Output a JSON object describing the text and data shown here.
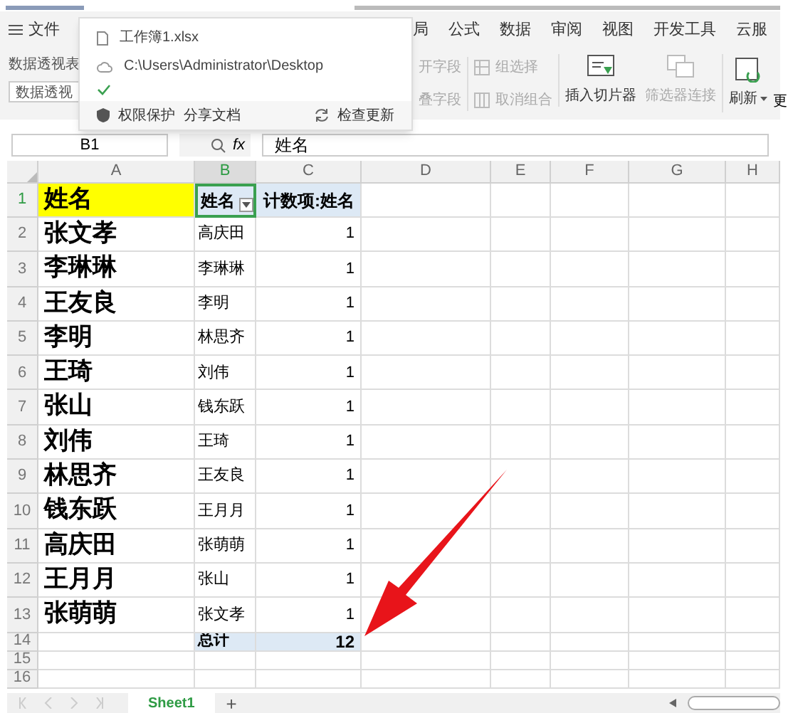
{
  "menu": {
    "file": "文件",
    "tabs": [
      {
        "label": "局",
        "selected": false
      },
      {
        "label": "公式",
        "selected": false
      },
      {
        "label": "数据",
        "selected": false
      },
      {
        "label": "审阅",
        "selected": false
      },
      {
        "label": "视图",
        "selected": false
      },
      {
        "label": "开发工具",
        "selected": false
      },
      {
        "label": "云服",
        "selected": false
      }
    ]
  },
  "ribbon": {
    "pivot_name_label": "数据透视表",
    "pivot_name_value": "数据透视",
    "expand": "开字段",
    "collapse": "叠字段",
    "group_select": "组选择",
    "ungroup": "取消组合",
    "insert_slicer": "插入切片器",
    "filter_connection": "筛选器连接",
    "refresh": "刷新",
    "more": "更"
  },
  "popup": {
    "file": "工作簿1.xlsx",
    "path": "C:\\Users\\Administrator\\Desktop",
    "saved": true,
    "protect": "权限保护",
    "share": "分享文档",
    "update": "检查更新"
  },
  "formula_bar": {
    "name_box": "B1",
    "fx": "fx",
    "value": "姓名"
  },
  "columns": [
    {
      "label": "A",
      "selected": false
    },
    {
      "label": "B",
      "selected": true
    },
    {
      "label": "C",
      "selected": false
    },
    {
      "label": "D",
      "selected": false
    },
    {
      "label": "E",
      "selected": false
    },
    {
      "label": "F",
      "selected": false
    },
    {
      "label": "G",
      "selected": false
    },
    {
      "label": "H",
      "selected": false
    }
  ],
  "rows": [
    {
      "num": "1",
      "kind": "header",
      "a": "姓名",
      "b": "姓名",
      "c": "计数项:姓名"
    },
    {
      "num": "2",
      "kind": "data",
      "a": "张文孝",
      "b": "高庆田",
      "c": "1"
    },
    {
      "num": "3",
      "kind": "data",
      "a": "李琳琳",
      "b": "李琳琳",
      "c": "1"
    },
    {
      "num": "4",
      "kind": "data",
      "a": "王友良",
      "b": "李明",
      "c": "1"
    },
    {
      "num": "5",
      "kind": "data",
      "a": "李明",
      "b": "林思齐",
      "c": "1"
    },
    {
      "num": "6",
      "kind": "data",
      "a": "王琦",
      "b": "刘伟",
      "c": "1"
    },
    {
      "num": "7",
      "kind": "data",
      "a": "张山",
      "b": "钱东跃",
      "c": "1"
    },
    {
      "num": "8",
      "kind": "data",
      "a": "刘伟",
      "b": "王琦",
      "c": "1"
    },
    {
      "num": "9",
      "kind": "data",
      "a": "林思齐",
      "b": "王友良",
      "c": "1"
    },
    {
      "num": "10",
      "kind": "data",
      "a": "钱东跃",
      "b": "王月月",
      "c": "1"
    },
    {
      "num": "11",
      "kind": "data",
      "a": "高庆田",
      "b": "张萌萌",
      "c": "1"
    },
    {
      "num": "12",
      "kind": "data",
      "a": "王月月",
      "b": "张山",
      "c": "1"
    },
    {
      "num": "13",
      "kind": "data",
      "a": "张萌萌",
      "b": "张文孝",
      "c": "1"
    },
    {
      "num": "14",
      "kind": "total",
      "b": "总计",
      "c": "12"
    },
    {
      "num": "15",
      "kind": "empty"
    },
    {
      "num": "16",
      "kind": "empty"
    }
  ],
  "sheets": [
    {
      "label": "Sheet1",
      "selected": true
    }
  ],
  "add_sheet": "+"
}
